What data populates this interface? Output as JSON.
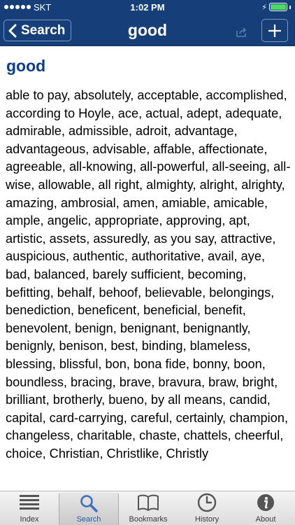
{
  "status_bar": {
    "carrier": "SKT",
    "time": "1:02 PM"
  },
  "nav": {
    "back_label": "Search",
    "title": "good"
  },
  "entry": {
    "headword": "good",
    "synonyms": "able to pay, absolutely, acceptable, accomplished, according to Hoyle, ace, actual, adept, adequate, admirable, admissible, adroit, advantage, advantageous, advisable, affable, affectionate, agreeable, all-knowing, all-powerful, all-seeing, all-wise, allowable, all right, almighty, alright, alrighty, amazing, ambrosial, amen, amiable, amicable, ample, angelic, appropriate, approving, apt, artistic, assets, assuredly, as you say, attractive, auspicious, authentic, authoritative, avail, aye, bad, balanced, barely sufficient, becoming, befitting, behalf, behoof, believable, belongings, benediction, beneficent, beneficial, benefit, benevolent, benign, benignant, benignantly, benignly, benison, best, binding, blameless, blessing, blissful, bon, bona fide, bonny, boon, boundless, bracing, brave, bravura, braw, bright, brilliant, brotherly, bueno, by all means, candid, capital, card-carrying, careful, certainly, champion, changeless, charitable, chaste, chattels, cheerful, choice, Christian, Christlike, Christly"
  },
  "tabs": [
    {
      "label": "Index",
      "icon": "list-icon"
    },
    {
      "label": "Search",
      "icon": "magnifier-icon"
    },
    {
      "label": "Bookmarks",
      "icon": "book-icon"
    },
    {
      "label": "History",
      "icon": "clock-icon"
    },
    {
      "label": "About",
      "icon": "info-icon"
    }
  ],
  "colors": {
    "nav_background": "#163f79",
    "headword": "#0f3d8c",
    "active_tab_label": "#2a5aa8",
    "battery_fill": "#4cd964"
  }
}
